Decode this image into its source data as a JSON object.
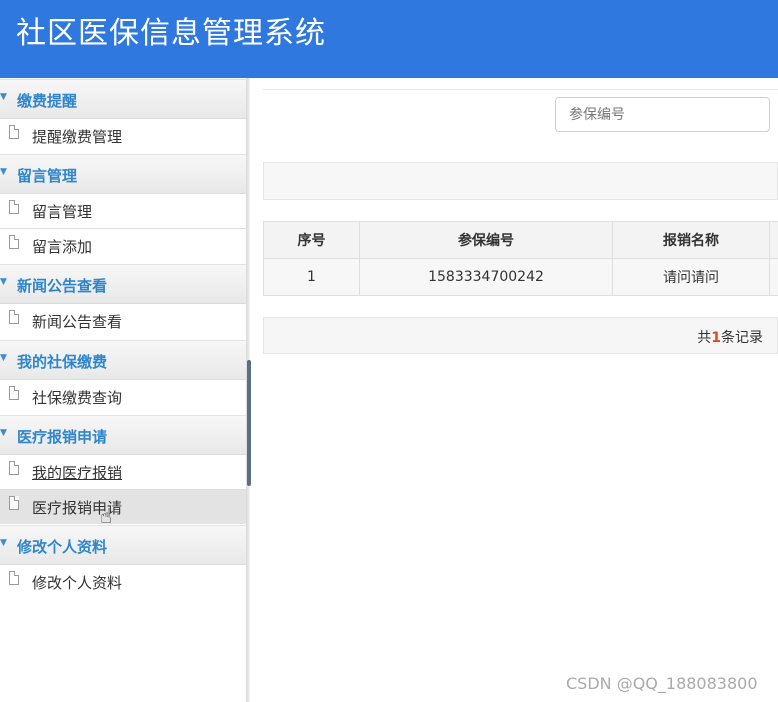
{
  "app": {
    "title": "社区医保信息管理系统"
  },
  "sidebar": {
    "groups": [
      {
        "label": "缴费提醒",
        "items": [
          {
            "label": "提醒缴费管理"
          }
        ]
      },
      {
        "label": "留言管理",
        "items": [
          {
            "label": "留言管理"
          },
          {
            "label": "留言添加"
          }
        ]
      },
      {
        "label": "新闻公告查看",
        "items": [
          {
            "label": "新闻公告查看"
          }
        ]
      },
      {
        "label": "我的社保缴费",
        "items": [
          {
            "label": "社保缴费查询"
          }
        ]
      },
      {
        "label": "医疗报销申请",
        "items": [
          {
            "label": "我的医疗报销"
          },
          {
            "label": "医疗报销申请"
          }
        ]
      },
      {
        "label": "修改个人资料",
        "items": [
          {
            "label": "修改个人资料"
          }
        ]
      }
    ]
  },
  "search": {
    "placeholder": "参保编号"
  },
  "table": {
    "columns": [
      "序号",
      "参保编号",
      "报销名称"
    ],
    "rows": [
      [
        "1",
        "1583334700242",
        "请问请问"
      ]
    ]
  },
  "pager": {
    "prefix": "共",
    "count": "1",
    "suffix": "条记录"
  },
  "watermark": "CSDN @QQ_188083800"
}
